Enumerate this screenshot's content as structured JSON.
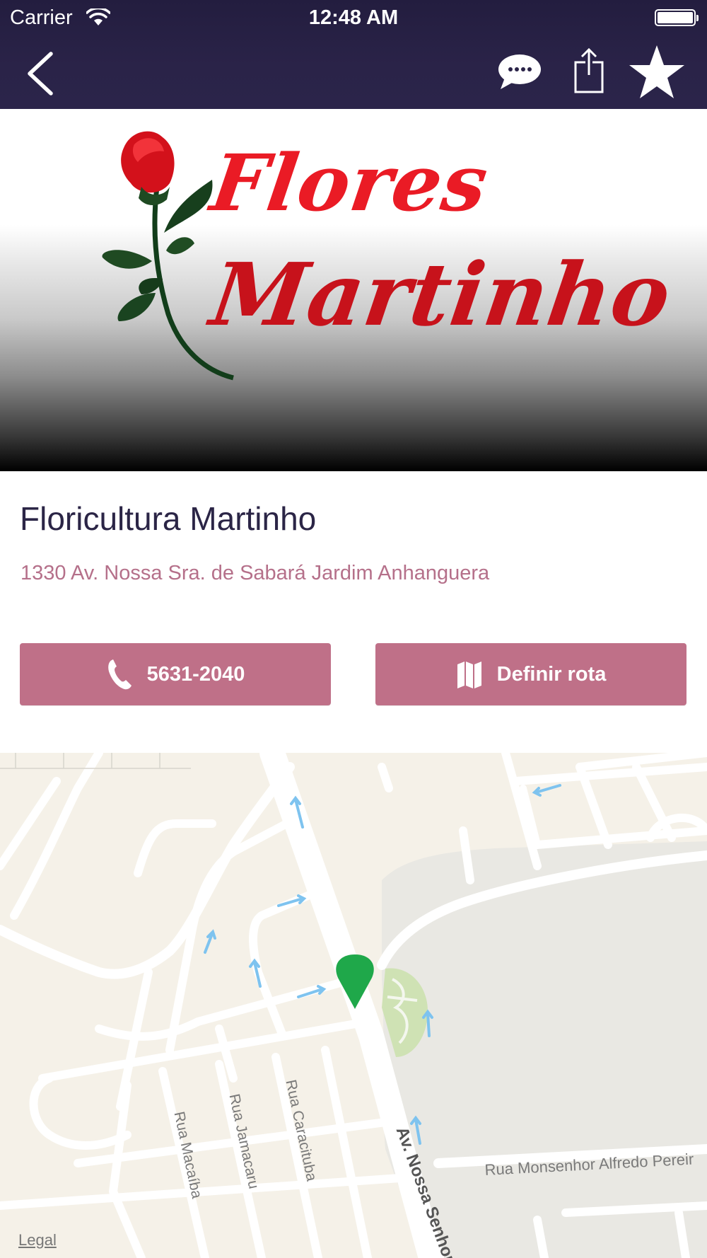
{
  "status_bar": {
    "carrier": "Carrier",
    "time": "12:48 AM"
  },
  "nav": {
    "icons": [
      "chevron-left-icon",
      "chat-bubble-icon",
      "share-icon",
      "star-icon"
    ]
  },
  "hero": {
    "logo_line1": "Flores",
    "logo_line2": "Martinho"
  },
  "place": {
    "name": "Floricultura Martinho",
    "address": "1330 Av. Nossa Sra. de Sabará Jardim Anhanguera"
  },
  "actions": {
    "call_label": "5631-2040",
    "route_label": "Definir rota"
  },
  "map": {
    "streets": {
      "macaiba": "Rua Macaíba",
      "jamacaru": "Rua Jamacaru",
      "caracituba": "Rua Caracituba",
      "avenue": "Av. Nossa Senhor",
      "monsenhor": "Rua Monsenhor Alfredo Pereir"
    },
    "legal": "Legal"
  },
  "colors": {
    "header": "#2a2348",
    "accent": "#bf7088",
    "address": "#b5708a",
    "pin": "#1fa84a"
  }
}
